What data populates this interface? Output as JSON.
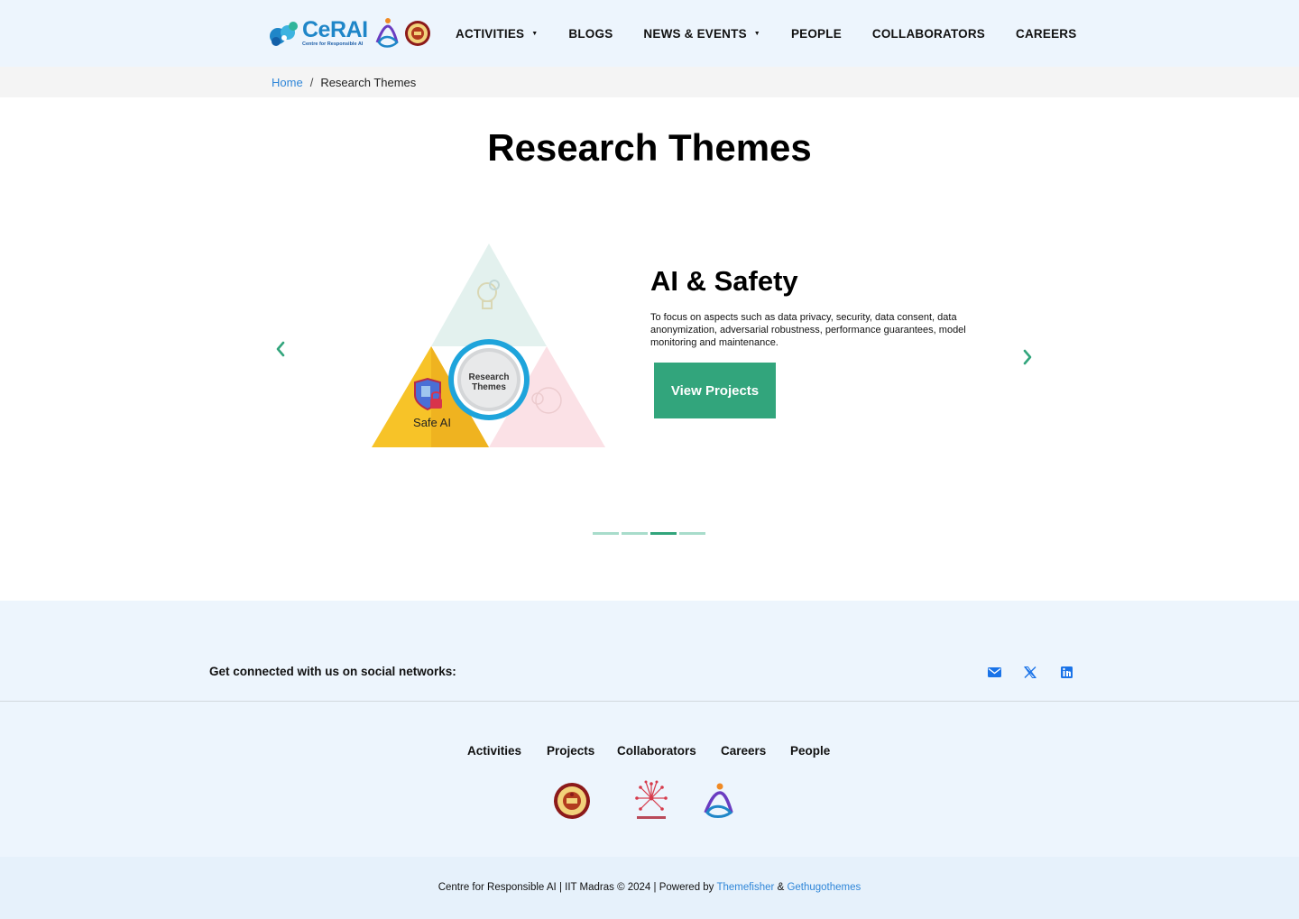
{
  "header": {
    "logo_text": "CeRAI",
    "logo_subtitle": "Centre for Responsible AI",
    "wsai_label": "WSAI IITM",
    "nav": [
      {
        "label": "ACTIVITIES",
        "has_dropdown": true
      },
      {
        "label": "BLOGS",
        "has_dropdown": false
      },
      {
        "label": "NEWS & EVENTS",
        "has_dropdown": true
      },
      {
        "label": "PEOPLE",
        "has_dropdown": false
      },
      {
        "label": "COLLABORATORS",
        "has_dropdown": false
      },
      {
        "label": "CAREERS",
        "has_dropdown": false
      }
    ],
    "caret": "▼"
  },
  "breadcrumb": {
    "home": "Home",
    "separator": "/",
    "current": "Research Themes"
  },
  "page": {
    "title": "Research Themes"
  },
  "slide": {
    "title": "AI & Safety",
    "description": "To focus on aspects such as data privacy, security, data consent, data  anonymization, adversarial robustness, performance guarantees, model  monitoring and maintenance.",
    "button": "View Projects",
    "diagram_center_line1": "Research",
    "diagram_center_line2": "Themes",
    "diagram_label": "Safe AI",
    "active_index": 2,
    "total": 4
  },
  "social": {
    "text": "Get connected with us on social networks:",
    "icons": [
      "mail-icon",
      "x-twitter-icon",
      "linkedin-icon"
    ]
  },
  "footer": {
    "links": [
      "Activities",
      "Projects",
      "Collaborators",
      "Careers",
      "People"
    ]
  },
  "copyright": {
    "text": "Centre for Responsible AI | IIT Madras © 2024 | Powered by",
    "link1": "Themefisher",
    "amp": "&",
    "link2": "Gethugothemes"
  },
  "colors": {
    "accent": "#32a57c",
    "link": "#2f86d8",
    "header_bg": "#edf5fd",
    "safe_ai_yellow": "#f7c328"
  }
}
